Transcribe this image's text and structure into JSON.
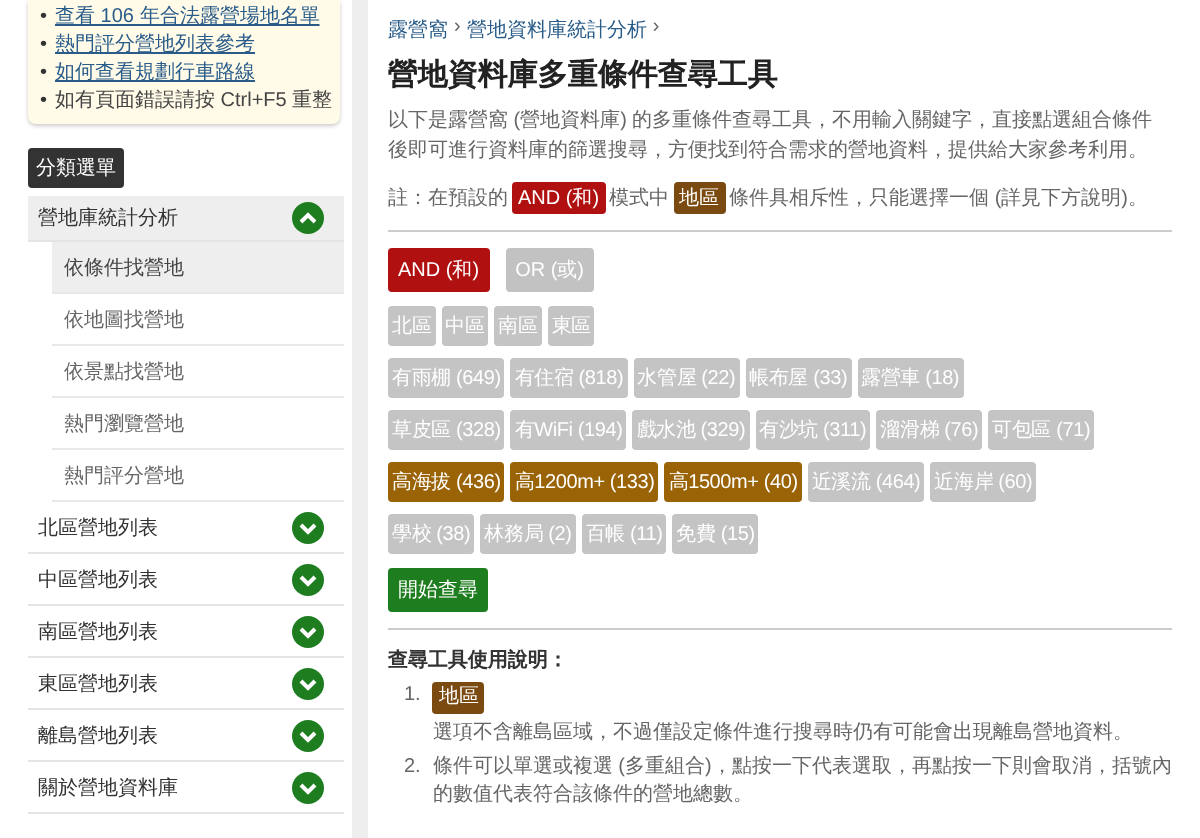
{
  "sidebar": {
    "bullet": "•",
    "links": [
      {
        "text": "查看 106 年合法露營場地名單",
        "link": true
      },
      {
        "text": "熱門評分營地列表參考",
        "link": true
      },
      {
        "text": "如何查看規劃行車路線",
        "link": true
      },
      {
        "text": "如有頁面錯誤請按 Ctrl+F5 重整",
        "link": false
      }
    ],
    "menu_title": "分類選單",
    "menu": [
      {
        "label": "營地庫統計分析",
        "expanded": true,
        "children": [
          {
            "label": "依條件找營地",
            "selected": true
          },
          {
            "label": "依地圖找營地",
            "selected": false
          },
          {
            "label": "依景點找營地",
            "selected": false
          },
          {
            "label": "熱門瀏覽營地",
            "selected": false
          },
          {
            "label": "熱門評分營地",
            "selected": false
          }
        ]
      },
      {
        "label": "北區營地列表",
        "expanded": false
      },
      {
        "label": "中區營地列表",
        "expanded": false
      },
      {
        "label": "南區營地列表",
        "expanded": false
      },
      {
        "label": "東區營地列表",
        "expanded": false
      },
      {
        "label": "離島營地列表",
        "expanded": false
      },
      {
        "label": "關於營地資料庫",
        "expanded": false
      }
    ]
  },
  "breadcrumb": [
    "露營窩",
    "營地資料庫統計分析"
  ],
  "breadcrumb_separator": "›",
  "title": "營地資料庫多重條件查尋工具",
  "intro": "以下是露營窩 (營地資料庫) 的多重條件查尋工具，不用輸入關鍵字，直接點選組合條件後即可進行資料庫的篩選搜尋，方便找到符合需求的營地資料，提供給大家參考利用。",
  "note": {
    "prefix": "註：在預設的",
    "mode_badge": "AND (和)",
    "middle": "模式中",
    "area_badge": "地區",
    "suffix": "條件具相斥性，只能選擇一個 (詳見下方說明)。"
  },
  "modes": [
    {
      "label": "AND (和)",
      "selected": true
    },
    {
      "label": "OR (或)",
      "selected": false
    }
  ],
  "tag_rows": [
    [
      {
        "label": "北區",
        "selected": false
      },
      {
        "label": "中區",
        "selected": false
      },
      {
        "label": "南區",
        "selected": false
      },
      {
        "label": "東區",
        "selected": false
      }
    ],
    [
      {
        "label": "有雨棚 (649)",
        "selected": false
      },
      {
        "label": "有住宿 (818)",
        "selected": false
      },
      {
        "label": "水管屋 (22)",
        "selected": false
      },
      {
        "label": "帳布屋 (33)",
        "selected": false
      },
      {
        "label": "露營車 (18)",
        "selected": false
      }
    ],
    [
      {
        "label": "草皮區 (328)",
        "selected": false
      },
      {
        "label": "有WiFi (194)",
        "selected": false
      },
      {
        "label": "戲水池 (329)",
        "selected": false
      },
      {
        "label": "有沙坑 (311)",
        "selected": false
      },
      {
        "label": "溜滑梯 (76)",
        "selected": false
      },
      {
        "label": "可包區 (71)",
        "selected": false
      }
    ],
    [
      {
        "label": "高海拔 (436)",
        "selected": true
      },
      {
        "label": "高1200m+ (133)",
        "selected": true
      },
      {
        "label": "高1500m+ (40)",
        "selected": true
      },
      {
        "label": "近溪流 (464)",
        "selected": false
      },
      {
        "label": "近海岸 (60)",
        "selected": false
      }
    ],
    [
      {
        "label": "學校 (38)",
        "selected": false
      },
      {
        "label": "林務局 (2)",
        "selected": false
      },
      {
        "label": "百帳 (11)",
        "selected": false
      },
      {
        "label": "免費 (15)",
        "selected": false
      }
    ]
  ],
  "search_button": "開始查尋",
  "help_title": "查尋工具使用說明：",
  "help": [
    {
      "number": "1.",
      "badge": "地區",
      "text": "選項不含離島區域，不過僅設定條件進行搜尋時仍有可能會出現離島營地資料。"
    },
    {
      "number": "2.",
      "text": "條件可以單選或複選 (多重組合)，點按一下代表選取，再點按一下則會取消，括號內的數值代表符合該條件的營地總數。"
    }
  ]
}
